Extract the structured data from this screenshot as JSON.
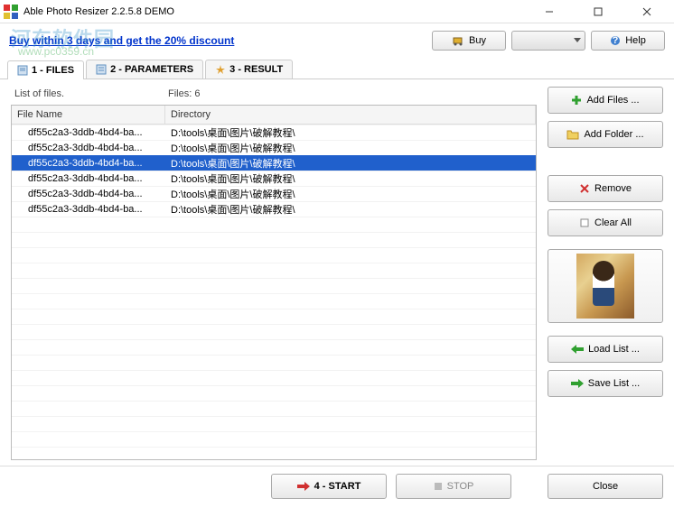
{
  "window": {
    "title": "Able Photo Resizer 2.2.5.8 DEMO"
  },
  "toolbar": {
    "promo_text": "Buy within 3 days and get the 20% discount",
    "buy_label": "Buy",
    "help_label": "Help"
  },
  "watermark": {
    "line1": "河东软件园",
    "line2": "www.pc0359.cn"
  },
  "tabs": {
    "files": "1 - FILES",
    "parameters": "2 - PARAMETERS",
    "result": "3 - RESULT"
  },
  "list": {
    "label_list": "List of files.",
    "label_count": "Files: 6",
    "header_name": "File Name",
    "header_dir": "Directory",
    "rows": [
      {
        "name": "df55c2a3-3ddb-4bd4-ba...",
        "dir": "D:\\tools\\桌面\\图片\\破解教程\\",
        "selected": false
      },
      {
        "name": "df55c2a3-3ddb-4bd4-ba...",
        "dir": "D:\\tools\\桌面\\图片\\破解教程\\",
        "selected": false
      },
      {
        "name": "df55c2a3-3ddb-4bd4-ba...",
        "dir": "D:\\tools\\桌面\\图片\\破解教程\\",
        "selected": true
      },
      {
        "name": "df55c2a3-3ddb-4bd4-ba...",
        "dir": "D:\\tools\\桌面\\图片\\破解教程\\",
        "selected": false
      },
      {
        "name": "df55c2a3-3ddb-4bd4-ba...",
        "dir": "D:\\tools\\桌面\\图片\\破解教程\\",
        "selected": false
      },
      {
        "name": "df55c2a3-3ddb-4bd4-ba...",
        "dir": "D:\\tools\\桌面\\图片\\破解教程\\",
        "selected": false
      }
    ]
  },
  "side": {
    "add_files": "Add Files ...",
    "add_folder": "Add Folder ...",
    "remove": "Remove",
    "clear_all": "Clear All",
    "load_list": "Load List ...",
    "save_list": "Save List ..."
  },
  "bottom": {
    "start": "4 - START",
    "stop": "STOP",
    "close": "Close"
  }
}
